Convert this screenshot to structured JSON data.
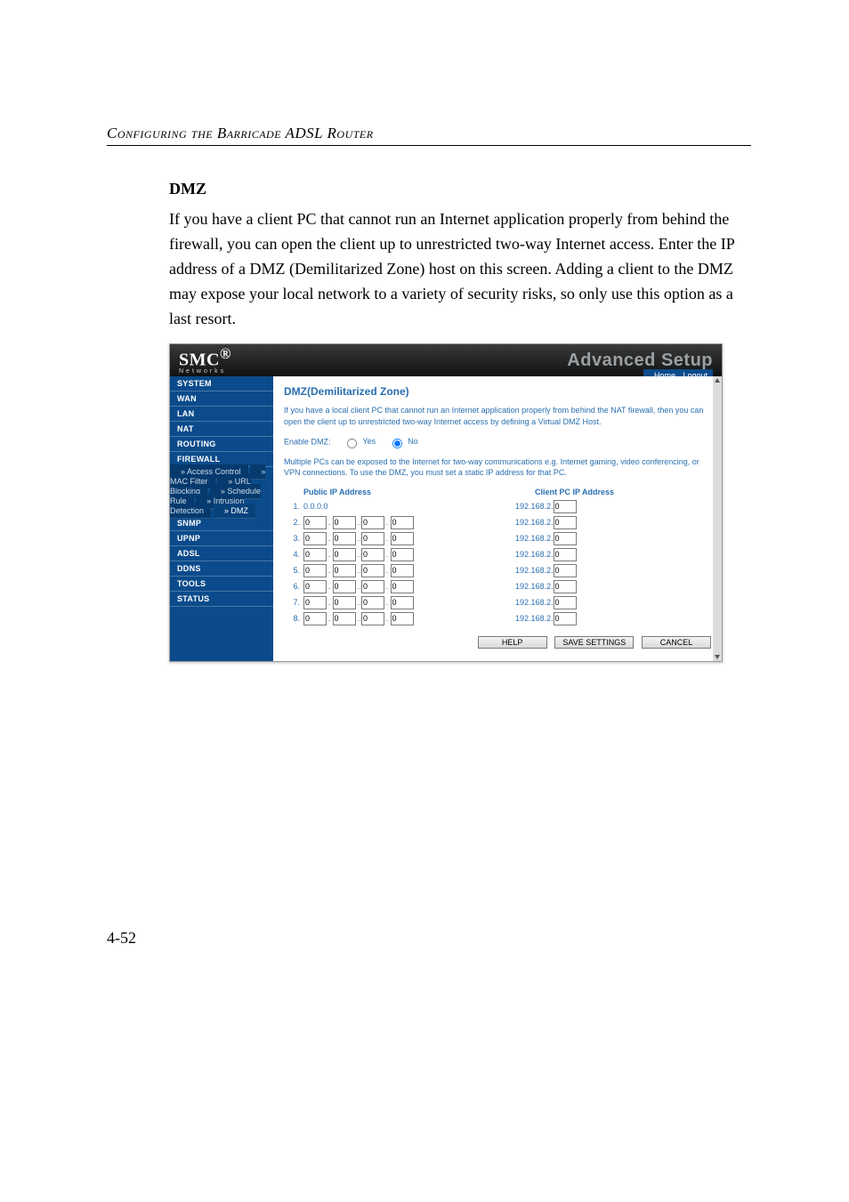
{
  "running_head": "Configuring the Barricade ADSL Router",
  "section_title": "DMZ",
  "body_paragraph": "If you have a client PC that cannot run an Internet application properly from behind the firewall, you can open the client up to unrestricted two-way Internet access. Enter the IP address of a DMZ (Demilitarized Zone) host on this screen. Adding a client to the DMZ may expose your local network to a variety of security risks, so only use this option as a last resort.",
  "page_num": "4-52",
  "header": {
    "logo_main": "SMC",
    "logo_reg": "®",
    "logo_sub": "Networks",
    "product": "Advanced Setup",
    "home": "Home",
    "logout": "Logout"
  },
  "sidebar": {
    "items": [
      {
        "label": "SYSTEM",
        "top": true
      },
      {
        "label": "WAN",
        "top": true
      },
      {
        "label": "LAN",
        "top": true
      },
      {
        "label": "NAT",
        "top": true
      },
      {
        "label": "ROUTING",
        "top": true
      },
      {
        "label": "FIREWALL",
        "top": true
      }
    ],
    "subs": [
      {
        "label": "» Access Control"
      },
      {
        "label": "» MAC Filter"
      },
      {
        "label": "» URL Blocking"
      },
      {
        "label": "» Schedule Rule"
      },
      {
        "label": "» Intrusion Detection"
      },
      {
        "label": "» DMZ",
        "active": true
      }
    ],
    "items2": [
      {
        "label": "SNMP",
        "top": true
      },
      {
        "label": "UPnP",
        "top": true
      },
      {
        "label": "ADSL",
        "top": true
      },
      {
        "label": "DDNS",
        "top": true
      },
      {
        "label": "TOOLS",
        "top": true
      },
      {
        "label": "STATUS",
        "top": true
      }
    ]
  },
  "main": {
    "title": "DMZ(Demilitarized Zone)",
    "desc": "If you have a local client PC that cannot run an Internet application properly from behind the NAT firewall, then you can open the client up to unrestricted two-way Internet access by defining a Virtual DMZ Host.",
    "enable_label": "Enable DMZ:",
    "yes": "Yes",
    "no": "No",
    "note": "Multiple PCs can be exposed to the Internet for two-way communications e.g. Internet gaming, video conferencing, or VPN connections.  To use the DMZ, you must set a static IP address for that PC.",
    "col_public": "Public IP Address",
    "col_client": "Client PC IP Address",
    "client_prefix": "192.168.2.",
    "rows": [
      {
        "idx": "1.",
        "fixed": "0.0.0.0",
        "client": "0"
      },
      {
        "idx": "2.",
        "a": "0",
        "b": "0",
        "c": "0",
        "d": "0",
        "client": "0"
      },
      {
        "idx": "3.",
        "a": "0",
        "b": "0",
        "c": "0",
        "d": "0",
        "client": "0"
      },
      {
        "idx": "4.",
        "a": "0",
        "b": "0",
        "c": "0",
        "d": "0",
        "client": "0"
      },
      {
        "idx": "5.",
        "a": "0",
        "b": "0",
        "c": "0",
        "d": "0",
        "client": "0"
      },
      {
        "idx": "6.",
        "a": "0",
        "b": "0",
        "c": "0",
        "d": "0",
        "client": "0"
      },
      {
        "idx": "7.",
        "a": "0",
        "b": "0",
        "c": "0",
        "d": "0",
        "client": "0"
      },
      {
        "idx": "8.",
        "a": "0",
        "b": "0",
        "c": "0",
        "d": "0",
        "client": "0"
      }
    ],
    "help": "HELP",
    "save": "SAVE SETTINGS",
    "cancel": "CANCEL"
  }
}
